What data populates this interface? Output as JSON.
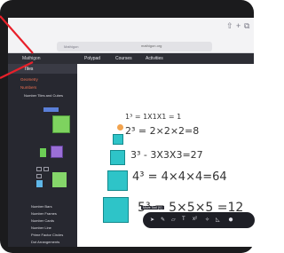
{
  "browser": {
    "url": "mathigon.org",
    "tab_a": "Mathigon",
    "share_icon": "share-icon",
    "add_icon": "plus-icon",
    "tabs_icon": "tabs-icon"
  },
  "appbar": {
    "brand": "Mathigon",
    "nav": [
      "Polypad",
      "Courses",
      "Activities"
    ]
  },
  "sidebar": {
    "header": "Tiles",
    "categories": [
      "Geometry",
      "Numbers"
    ],
    "section": "Number Tiles and Cubes",
    "bottom_items": [
      "Number Bars",
      "Number Frames",
      "Number Cards",
      "Number Line",
      "Prime Factor Circles",
      "Dot Arrangements"
    ]
  },
  "canvas": {
    "equations": [
      "1³ = 1X1X1 = 1",
      "2³ = 2×2×2=8",
      "3³ - 3X3X3=27",
      "4³ = 4×4×4=64",
      "5³ = 5×5×5 =12"
    ]
  },
  "toolbar": {
    "caption": "Move Tool (V)",
    "tools": [
      "cursor-icon",
      "pen-icon",
      "eraser-icon",
      "text-icon",
      "math-icon",
      "magic-icon",
      "shape-icon",
      "circle-icon"
    ]
  }
}
